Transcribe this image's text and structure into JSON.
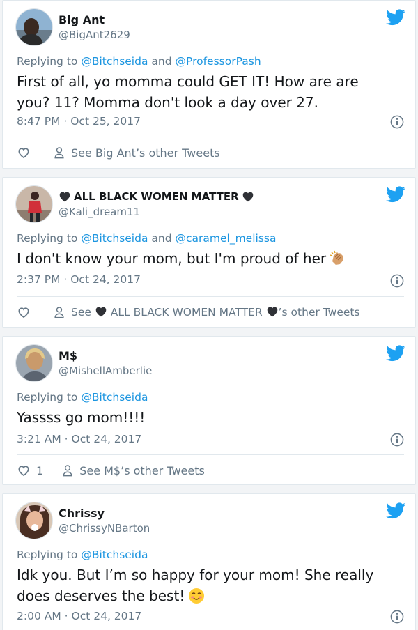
{
  "colors": {
    "link": "#1b95e0",
    "muted": "#657786",
    "text": "#14171a",
    "border": "#e1e8ed"
  },
  "tweets": [
    {
      "name": "Big Ant",
      "handle": "@BigAnt2629",
      "replying_prefix": "Replying to",
      "replying_to_1": "@Bitchseida",
      "replying_and": "and",
      "replying_to_2": "@ProfessorPash",
      "text_line1": "First of all, yo momma could GET IT!  How are are",
      "text_line2": "you?  11?  Momma don't look a day over 27.",
      "timestamp": "8:47 PM · Oct 25, 2017",
      "see_other": "See Big Ant’s other Tweets"
    },
    {
      "name": "ALL BLACK WOMEN MATTER",
      "handle": "@Kali_dream11",
      "replying_prefix": "Replying to",
      "replying_to_1": "@Bitchseida",
      "replying_and": "and",
      "replying_to_2": "@caramel_melissa",
      "text_line1": "I don't know your mom, but I'm proud of her",
      "timestamp": "2:37 PM · Oct 24, 2017",
      "see_prefix": "See",
      "see_name": "ALL BLACK WOMEN MATTER",
      "see_suffix": "’s other Tweets"
    },
    {
      "name": "M$",
      "handle": "@MishellAmberlie",
      "replying_prefix": "Replying to",
      "replying_to_1": "@Bitchseida",
      "text_line1": "Yassss go mom!!!!",
      "timestamp": "3:21 AM · Oct 24, 2017",
      "like_count": "1",
      "see_other": "See M$’s other Tweets"
    },
    {
      "name": "Chrissy",
      "handle": "@ChrissyNBarton",
      "replying_prefix": "Replying to",
      "replying_to_1": "@Bitchseida",
      "text_line1": "Idk you. But I’m so happy for your mom! She really",
      "text_line2": "does deserves the best!",
      "timestamp": "2:00 AM · Oct 24, 2017"
    }
  ],
  "icons": {
    "bird": "twitter-bird-icon",
    "info": "info-icon",
    "heart": "heart-icon",
    "person": "person-icon",
    "black_heart": "black-heart-icon",
    "clap_emoji": "clapping-hands-emoji",
    "smile_emoji": "smiling-face-emoji"
  }
}
